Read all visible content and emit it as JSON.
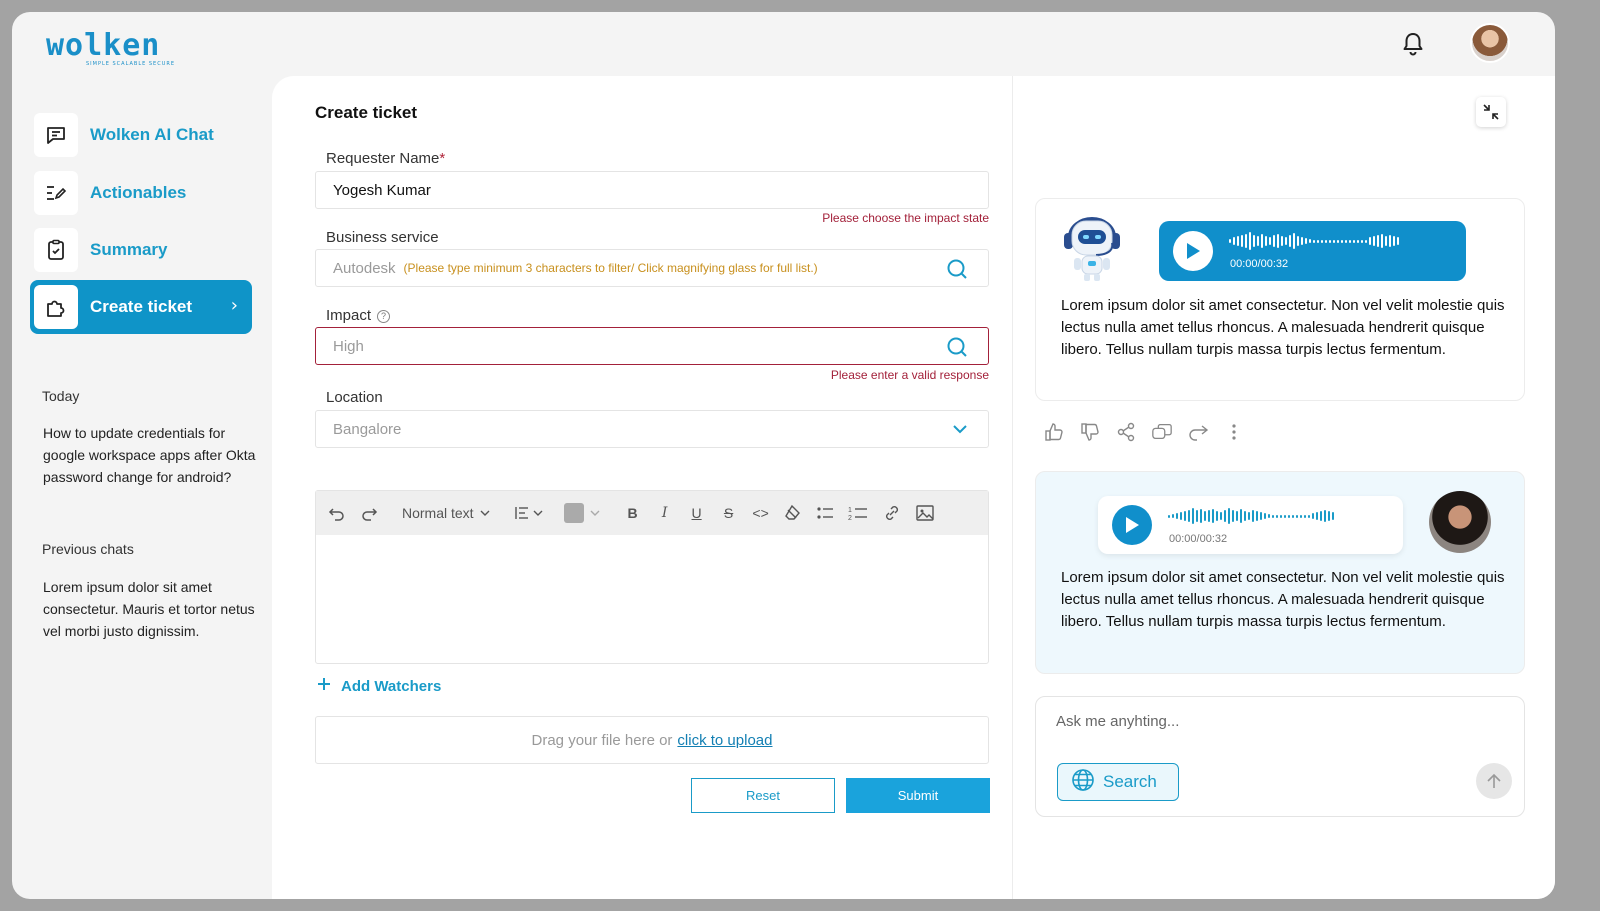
{
  "app": {
    "logo_text": "wolken",
    "logo_tagline": "SIMPLE SCALABLE SECURE"
  },
  "header": {
    "bell_icon": "bell-icon",
    "avatar": "user-avatar"
  },
  "sidebar": {
    "items": [
      {
        "label": "Wolken AI Chat",
        "icon": "chat-bubble-icon"
      },
      {
        "label": "Actionables",
        "icon": "list-edit-icon"
      },
      {
        "label": "Summary",
        "icon": "clipboard-check-icon"
      },
      {
        "label": "Create ticket",
        "icon": "puzzle-icon",
        "active": true
      }
    ],
    "today_label": "Today",
    "today_chat": "How to update credentials for google workspace apps after Okta password change for android?",
    "previous_label": "Previous chats",
    "previous_chat": "Lorem ipsum dolor sit amet consectetur. Mauris et tortor netus vel morbi justo dignissim."
  },
  "form": {
    "title": "Create ticket",
    "requester": {
      "label": "Requester Name",
      "required_mark": "*",
      "value": "Yogesh Kumar",
      "error": "Please choose the impact state"
    },
    "business_service": {
      "label": "Business service",
      "placeholder": "Autodesk",
      "hint": "(Please type minimum 3 characters to filter/ Click magnifying glass for full list.)"
    },
    "impact": {
      "label": "Impact",
      "help": "?",
      "placeholder": "High",
      "error": "Please enter a valid response"
    },
    "location": {
      "label": "Location",
      "placeholder": "Bangalore"
    },
    "editor": {
      "text_style": "Normal text"
    },
    "add_watchers": "Add Watchers",
    "upload": {
      "text": "Drag your file here or",
      "link": "click to upload"
    },
    "reset_label": "Reset",
    "submit_label": "Submit"
  },
  "chat": {
    "bot_message": {
      "audio_time": "00:00/00:32",
      "text": "Lorem ipsum dolor sit amet consectetur. Non vel velit molestie quis lectus nulla amet tellus rhoncus. A malesuada hendrerit quisque libero. Tellus nullam turpis massa turpis lectus fermentum."
    },
    "user_message": {
      "audio_time": "00:00/00:32",
      "text": "Lorem ipsum dolor sit amet consectetur. Non vel velit molestie quis lectus nulla amet tellus rhoncus. A malesuada hendrerit quisque libero. Tellus nullam turpis massa turpis lectus fermentum."
    },
    "input_placeholder": "Ask me anyhting...",
    "search_label": "Search"
  },
  "colors": {
    "brand": "#1a9bc8",
    "active_nav": "#0f94c8",
    "error": "#a3213a",
    "hint": "#c8901e"
  }
}
